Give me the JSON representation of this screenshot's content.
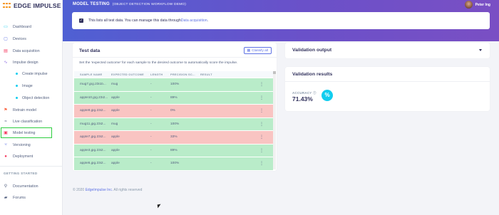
{
  "app": {
    "logo_text": "EDGE IMPULSE"
  },
  "sidebar": {
    "items": [
      {
        "label": "Dashboard",
        "icon": "monitor-icon"
      },
      {
        "label": "Devices",
        "icon": "devices-icon"
      },
      {
        "label": "Data acquisition",
        "icon": "data-icon"
      },
      {
        "label": "Impulse design",
        "icon": "impulse-icon"
      },
      {
        "label": "Create impulse",
        "icon": "dot-icon"
      },
      {
        "label": "Image",
        "icon": "dot-icon"
      },
      {
        "label": "Object detection",
        "icon": "dot-icon"
      },
      {
        "label": "Retrain model",
        "icon": "retrain-icon"
      },
      {
        "label": "Live classification",
        "icon": "live-icon"
      },
      {
        "label": "Model testing",
        "icon": "testing-icon"
      },
      {
        "label": "Versioning",
        "icon": "versioning-icon"
      },
      {
        "label": "Deployment",
        "icon": "deployment-icon"
      }
    ],
    "section_getting_started": "GETTING STARTED",
    "getting_started": [
      {
        "label": "Documentation",
        "icon": "documentation-icon"
      },
      {
        "label": "Forums",
        "icon": "forums-icon"
      }
    ]
  },
  "header": {
    "title": "MODEL TESTING",
    "subtitle": "(OBJECT DETECTION WORKFLOW DEMO)",
    "user_name": "Peter Ing"
  },
  "alert": {
    "text": "This lists all test data. You can manage this data through ",
    "link": "Data acquisition",
    "end": "."
  },
  "test_data": {
    "title": "Test data",
    "classify_all": "Classify all",
    "description": "Set the 'expected outcome' for each sample to the desired outcome to automatically score the impulse.",
    "columns": [
      "SAMPLE NAME",
      "EXPECTED OUTCOME",
      "LENGTH",
      "PRECISION SC...",
      "RESULT"
    ],
    "rows": [
      {
        "name": "mug7.jpg.23i1b...",
        "expected": "mug",
        "length": "-",
        "precision": "100%",
        "result": "",
        "status": "ok"
      },
      {
        "name": "apple10.jpg.23i2...",
        "expected": "apple",
        "length": "-",
        "precision": "89%",
        "result": "",
        "status": "ok"
      },
      {
        "name": "apple9.jpg.23i2...",
        "expected": "apple",
        "length": "-",
        "precision": "0%",
        "result": "",
        "status": "bad"
      },
      {
        "name": "mug11.jpg.23i2...",
        "expected": "mug",
        "length": "-",
        "precision": "100%",
        "result": "",
        "status": "ok"
      },
      {
        "name": "apple7.jpg.23i2...",
        "expected": "apple",
        "length": "-",
        "precision": "33%",
        "result": "",
        "status": "bad"
      },
      {
        "name": "apple3.jpg.23i2...",
        "expected": "apple",
        "length": "-",
        "precision": "89%",
        "result": "",
        "status": "ok"
      },
      {
        "name": "apple5.jpg.23i2...",
        "expected": "apple",
        "length": "-",
        "precision": "100%",
        "result": "",
        "status": "ok"
      }
    ]
  },
  "validation_output": {
    "title": "Validation output"
  },
  "validation_results": {
    "title": "Validation results",
    "accuracy_label": "ACCURACY",
    "accuracy_value": "71.43%",
    "accuracy_icon": "%"
  },
  "footer": {
    "text": "© 2020 ",
    "link": "EdgeImpulse Inc.",
    "end": " All rights reserved"
  },
  "colors": {
    "accent": "#5e72e4",
    "ok_row": "#b9ecc9",
    "bad_row": "#f9c4c2",
    "active_outline": "#2dce3f",
    "icon_cyan": "#11cdef"
  }
}
